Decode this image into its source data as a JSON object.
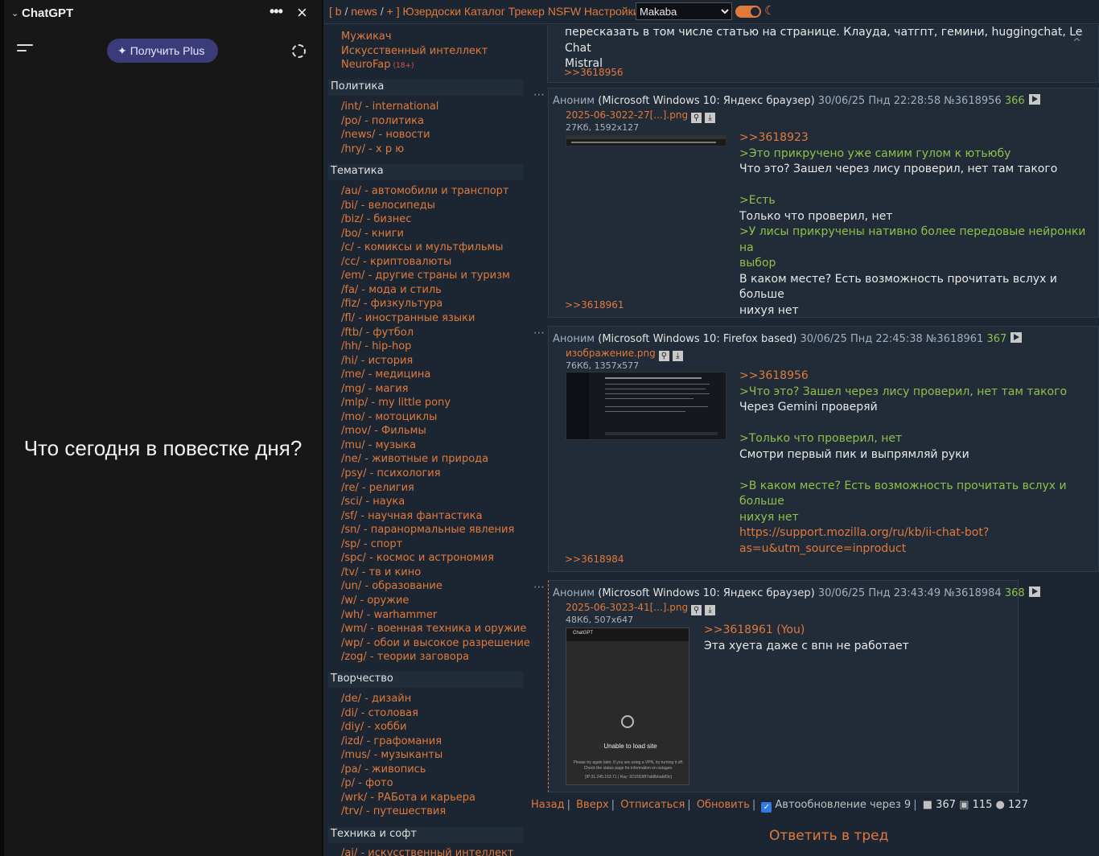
{
  "chatgpt": {
    "title": "ChatGPT",
    "more": "•••",
    "close": "×",
    "plus_label": "Получить Plus",
    "prompt": "Что сегодня в повестке дня?"
  },
  "topbar": {
    "bracket_open": "[",
    "b": "b",
    "slash1": "/",
    "news": "news",
    "slash2": "/",
    "plus": "+",
    "bracket_close": "]",
    "links": [
      "Юзердоски",
      "Каталог",
      "Трекер",
      "NSFW",
      "Настройки"
    ],
    "theme_select": "Makaba"
  },
  "boards": {
    "top_links": [
      {
        "label": "Мужикач"
      },
      {
        "label": "Искусственный интеллект"
      },
      {
        "label": "NeuroFap",
        "nsfw": "(18+)"
      }
    ],
    "categories": {
      "politics": "Политика",
      "thematic": "Тематика",
      "creative": "Творчество",
      "tech": "Техника и софт"
    },
    "politics": [
      "/int/ - international",
      "/po/ - политика",
      "/news/ - новости",
      "/hry/ - х р ю"
    ],
    "thematic": [
      "/au/ - автомобили и транспорт",
      "/bi/ - велосипеды",
      "/biz/ - бизнес",
      "/bo/ - книги",
      "/c/ - комиксы и мультфильмы",
      "/cc/ - криптовалюты",
      "/em/ - другие страны и туризм",
      "/fa/ - мода и стиль",
      "/fiz/ - физкультура",
      "/fl/ - иностранные языки",
      "/ftb/ - футбол",
      "/hh/ - hip-hop",
      "/hi/ - история",
      "/me/ - медицина",
      "/mg/ - магия",
      "/mlp/ - my little pony",
      "/mo/ - мотоциклы",
      "/mov/ - Фильмы",
      "/mu/ - музыка",
      "/ne/ - животные и природа",
      "/psy/ - психология",
      "/re/ - религия",
      "/sci/ - наука",
      "/sf/ - научная фантастика",
      "/sn/ - паранормальные явления",
      "/sp/ - спорт",
      "/spc/ - космос и астрономия",
      "/tv/ - тв и кино",
      "/un/ - образование",
      "/w/ - оружие",
      "/wh/ - warhammer",
      "/wm/ - военная техника и оружие",
      "/wp/ - обои и высокое разрешение",
      "/zog/ - теории заговора"
    ],
    "creative": [
      "/de/ - дизайн",
      "/di/ - столовая",
      "/diy/ - хобби",
      "/izd/ - графомания",
      "/mus/ - музыканты",
      "/pa/ - живопись",
      "/p/ - фото",
      "/wrk/ - РАБота и карьера",
      "/trv/ - путешествия"
    ],
    "tech": [
      "/ai/ - искусственный интеллект"
    ]
  },
  "posts": {
    "p0": {
      "text_line1": "пересказать в том числе статью на странице. Клауда, чатгпт, гемини, huggingchat, Le Chat",
      "text_line2": "Mistral",
      "reply": ">>3618956"
    },
    "p1": {
      "author": "Аноним",
      "ua": "(Microsoft Windows 10: Яндекс браузер)",
      "date": "30/06/25 Пнд 22:28:58",
      "id": "№3618956",
      "num": "366",
      "file": "2025-06-3022-27[...].png",
      "finfo": "27Кб, 1592x127",
      "lines": [
        {
          "t": ">>3618923",
          "k": "rl"
        },
        {
          "t": ">Это прикручено уже самим гулом к ютьюбу",
          "k": "q"
        },
        {
          "t": "Что это? Зашел через лису проверил, нет там такого",
          "k": ""
        },
        {
          "t": "",
          "k": ""
        },
        {
          "t": ">Есть",
          "k": "q"
        },
        {
          "t": "Только что проверил, нет",
          "k": ""
        },
        {
          "t": ">У лисы прикручены нативно более передовые нейронки на",
          "k": "q"
        },
        {
          "t": "выбор",
          "k": "q"
        },
        {
          "t": "В каком месте? Есть возможность прочитать вслух и больше",
          "k": ""
        },
        {
          "t": "нихуя нет",
          "k": ""
        }
      ],
      "reply": ">>3618961"
    },
    "p2": {
      "author": "Аноним",
      "ua": "(Microsoft Windows 10: Firefox based)",
      "date": "30/06/25 Пнд 22:45:38",
      "id": "№3618961",
      "num": "367",
      "file": "изображение.png",
      "finfo": "76Кб, 1357x577",
      "lines": [
        {
          "t": ">>3618956",
          "k": "rl"
        },
        {
          "t": ">Что это? Зашел через лису проверил, нет там такого",
          "k": "q"
        },
        {
          "t": "Через Gemini проверяй",
          "k": ""
        },
        {
          "t": "",
          "k": ""
        },
        {
          "t": ">Только что проверил, нет",
          "k": "q"
        },
        {
          "t": "Смотри первый пик и выпрямляй руки",
          "k": ""
        },
        {
          "t": "",
          "k": ""
        },
        {
          "t": ">В каком месте? Есть возможность прочитать вслух и больше",
          "k": "q"
        },
        {
          "t": "нихуя нет",
          "k": "q"
        },
        {
          "t": "https://support.mozilla.org/ru/kb/ii-chat-bot?",
          "k": "rl"
        },
        {
          "t": "as=u&utm_source=inproduct",
          "k": "rl"
        }
      ],
      "reply": ">>3618984"
    },
    "p3": {
      "author": "Аноним",
      "ua": "(Microsoft Windows 10: Яндекс браузер)",
      "date": "30/06/25 Пнд 23:43:49",
      "id": "№3618984",
      "num": "368",
      "file": "2025-06-3023-41[...].png",
      "finfo": "48Кб, 507x647",
      "thumb_title": "ChatGPT",
      "thumb_error": "Unable to load site",
      "thumb_small": "Please try again later. If you are using a VPN, try turning it off. Check the status page for information on outages.",
      "thumb_ip": "[IP:31.245.153.71 | Ray: 9210938f7ab8bbab83c]",
      "lines": [
        {
          "t": ">>3618961 (You)",
          "k": "rl"
        },
        {
          "t": "Эта хуета даже с впн не работает",
          "k": ""
        }
      ]
    }
  },
  "footer": {
    "back": "Назад",
    "up": "Вверх",
    "unsub": "Отписаться",
    "refresh": "Обновить",
    "autoupdate": "Автообновление через 9",
    "posts_count": "367",
    "images_count": "115",
    "users_count": "127",
    "reply_thread": "Ответить в тред"
  }
}
